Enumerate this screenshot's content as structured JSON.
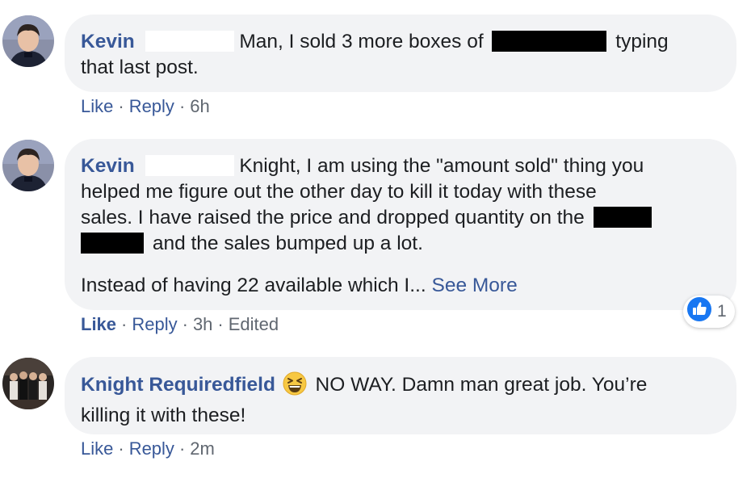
{
  "comments": [
    {
      "author": "Kevin",
      "text_1": "Man, I sold 3 more boxes of",
      "text_2": "typing",
      "text_3": "that last post.",
      "actions": {
        "like": "Like",
        "reply": "Reply",
        "time": "6h"
      }
    },
    {
      "author": "Kevin",
      "text_1": "Knight, I am using the \"amount sold\" thing you",
      "text_2": "helped me figure out the other day to kill it today with these",
      "text_3": "sales. I have raised the price and dropped quantity on the",
      "text_4": "and the sales bumped up a lot.",
      "text_5": "Instead of having 22 available which I...",
      "see_more": "See More",
      "actions": {
        "like": "Like",
        "reply": "Reply",
        "time": "3h",
        "edited": "Edited"
      },
      "reaction": {
        "icon": "like-reaction-icon",
        "count": "1"
      }
    },
    {
      "author": "Knight Requiredfield",
      "emoji": "grinning-squinting-face-icon",
      "text_1": "NO WAY. Damn man great job. You’re",
      "text_2": "killing it with these!",
      "actions": {
        "like": "Like",
        "reply": "Reply",
        "time": "2m"
      }
    }
  ],
  "colors": {
    "link": "#385898",
    "bubble": "#f2f3f5",
    "meta": "#606770"
  }
}
